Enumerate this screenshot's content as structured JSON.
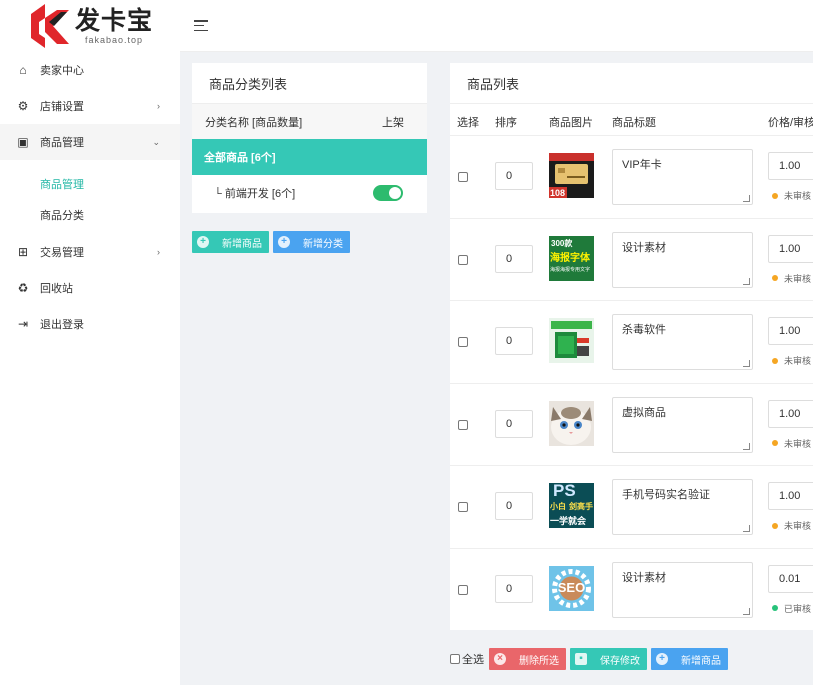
{
  "brand": {
    "name_cn": "发卡宝",
    "name_en": "fakabao.top",
    "accent": "#35c8b6",
    "logo_red": "#e0262b"
  },
  "sidebar": {
    "items": [
      {
        "label": "卖家中心",
        "icon": "home-icon",
        "glyph": "⌂"
      },
      {
        "label": "店铺设置",
        "icon": "gear-icon",
        "glyph": "⚙",
        "arrow": "›"
      },
      {
        "label": "商品管理",
        "icon": "bag-icon",
        "glyph": "▣",
        "arrow": "⌄"
      },
      {
        "label": "交易管理",
        "icon": "cart-icon",
        "glyph": "⊞",
        "arrow": "›"
      },
      {
        "label": "回收站",
        "icon": "recycle-icon",
        "glyph": "♻"
      },
      {
        "label": "退出登录",
        "icon": "logout-icon",
        "glyph": "⇥"
      }
    ],
    "submenu": [
      {
        "label": "商品管理",
        "selected": true
      },
      {
        "label": "商品分类",
        "selected": false
      }
    ]
  },
  "category_panel": {
    "title": "商品分类列表",
    "col_name": "分类名称 [商品数量]",
    "col_shelf": "上架",
    "all_label": "全部商品 [6个]",
    "rows": [
      {
        "label": "└ 前端开发 [6个]",
        "on_shelf": true
      }
    ],
    "btn_add_product": "新增商品",
    "btn_add_category": "新增分类"
  },
  "product_panel": {
    "title": "商品列表",
    "columns": [
      "选择",
      "排序",
      "商品图片",
      "商品标题",
      "价格/审核"
    ],
    "rows": [
      {
        "sort": "0",
        "title": "VIP年卡",
        "price": "1.00",
        "status": "未审核",
        "status_color": "#f5a623",
        "thumb": "vip"
      },
      {
        "sort": "0",
        "title": "设计素材",
        "price": "1.00",
        "status": "未审核",
        "status_color": "#f5a623",
        "thumb": "font"
      },
      {
        "sort": "0",
        "title": "杀毒软件",
        "price": "1.00",
        "status": "未审核",
        "status_color": "#f5a623",
        "thumb": "soft"
      },
      {
        "sort": "0",
        "title": "虚拟商品",
        "price": "1.00",
        "status": "未审核",
        "status_color": "#f5a623",
        "thumb": "cat"
      },
      {
        "sort": "0",
        "title": "手机号码实名验证",
        "price": "1.00",
        "status": "未审核",
        "status_color": "#f5a623",
        "thumb": "ps"
      },
      {
        "sort": "0",
        "title": "设计素材",
        "price": "0.01",
        "status": "已审核",
        "status_color": "#27c27a",
        "thumb": "seo"
      }
    ]
  },
  "thumb_text": {
    "vip_badge": "108",
    "font_lines": [
      "300款",
      "海报字体",
      "海报海报专用文字"
    ],
    "ps_lines": [
      "PS",
      "小白",
      "剑高手",
      "一学就会"
    ],
    "seo": "SEO"
  },
  "bottom": {
    "select_all": "全选",
    "delete_selected": "删除所选",
    "save_changes": "保存修改",
    "add_product": "新增商品"
  }
}
